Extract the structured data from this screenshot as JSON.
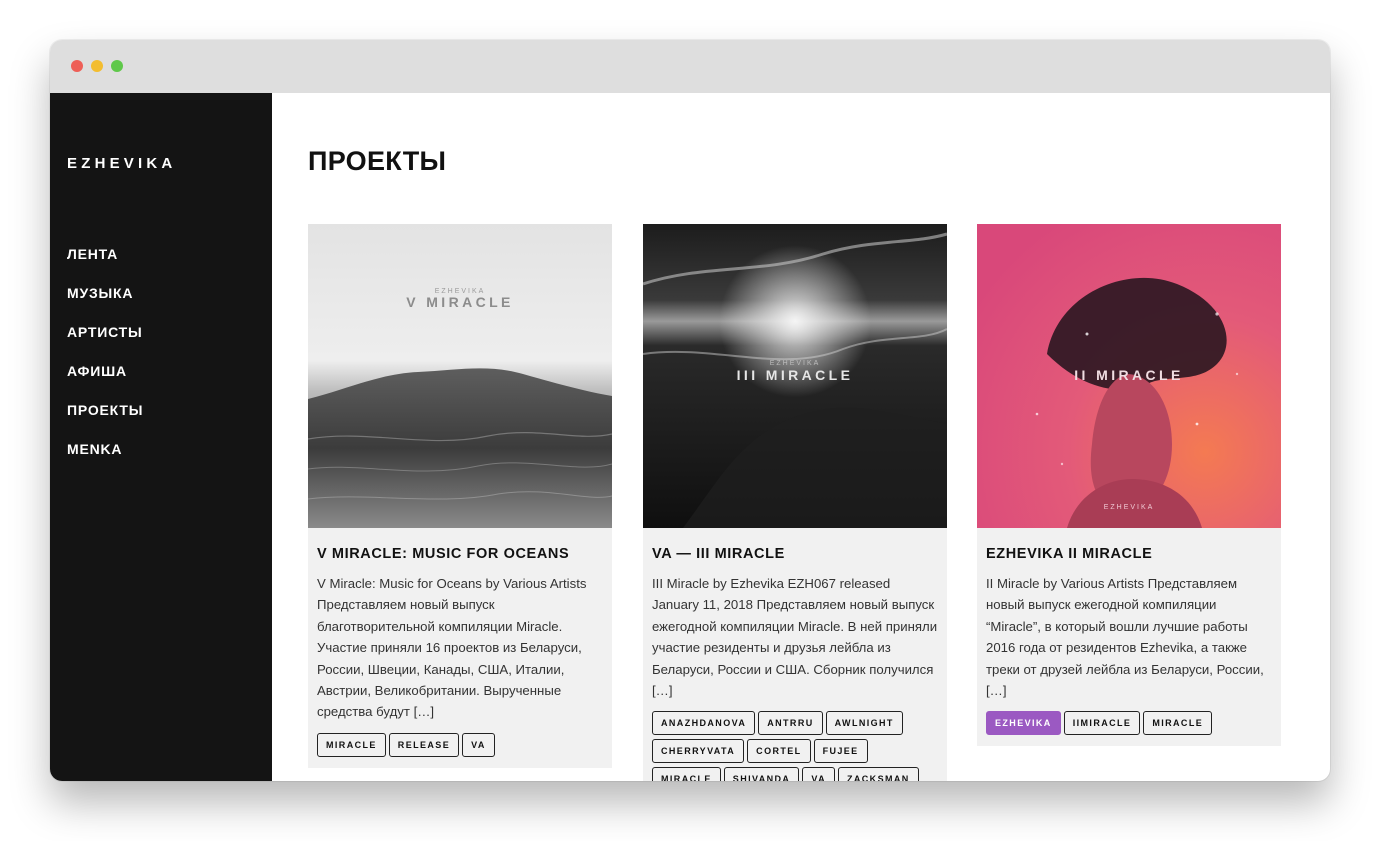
{
  "brand": "EZHEVIKA",
  "nav": [
    "ЛЕНТА",
    "МУЗЫКА",
    "АРТИСТЫ",
    "АФИША",
    "ПРОЕКТЫ",
    "MENKA"
  ],
  "page_title": "ПРОЕКТЫ",
  "cards": [
    {
      "cover_brand": "EZHEVIKA",
      "cover_title": "V MIRACLE",
      "title": "V MIRACLE: MUSIC FOR OCEANS",
      "excerpt": "V Miracle: Music for Oceans by Various Artists Представляем новый выпуск благотворительной компиляции Miracle. Участие приняли 16 проектов из Беларуси, России, Швеции, Канады, США, Италии, Австрии, Великобритании. Вырученные средства будут […]",
      "tags": [
        "MIRACLE",
        "RELEASE",
        "VA"
      ]
    },
    {
      "cover_brand": "EZHEVIKA",
      "cover_title": "III MIRACLE",
      "title": "VA — III MIRACLE",
      "excerpt": "III Miracle by Ezhevika EZH067 released January 11, 2018 Представляем новый выпуск ежегодной компиляции Miracle. В ней приняли участие резиденты и друзья лейбла из Беларуси, России и США. Сборник получился […]",
      "tags": [
        "ANAZHDANOVA",
        "ANTRRU",
        "AWLNIGHT",
        "CHERRYVATA",
        "CORTEL",
        "FUJEE",
        "MIRACLE",
        "SHIVANDA",
        "VA",
        "ZACKSMAN"
      ]
    },
    {
      "cover_brand": "EZHEVIKA",
      "cover_title": "II MIRACLE",
      "title": "EZHEVIKA II MIRACLE",
      "excerpt": "II Miracle by Various Artists Представляем новый выпуск ежегодной компиляции “Miracle”, в который вошли лучшие работы 2016 года от резидентов Ezhevika, а также треки от друзей лейбла из Беларуси, России, […]",
      "tags": [
        "EZHEVIKA",
        "IIMIRACLE",
        "MIRACLE"
      ],
      "active_tag": "EZHEVIKA",
      "active_tag_color": "#9b59c2"
    }
  ]
}
